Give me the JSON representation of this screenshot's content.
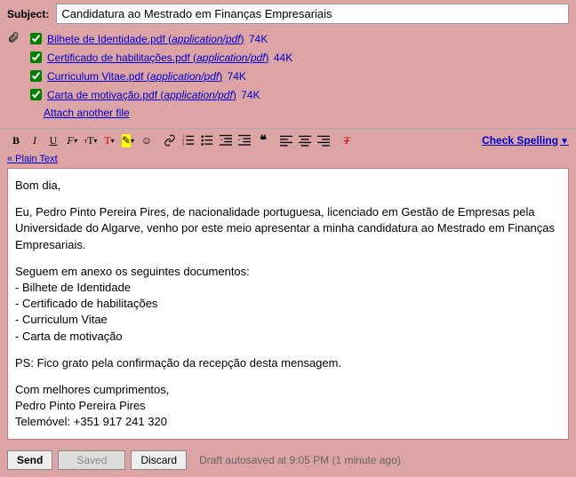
{
  "subject": {
    "label": "Subject:",
    "value": "Candidatura ao Mestrado em Finanças Empresariais"
  },
  "attachments": [
    {
      "name": "Bilhete de Identidade.pdf",
      "type": "application/pdf",
      "size": "74K"
    },
    {
      "name": "Certificado de habilitações.pdf",
      "type": "application/pdf",
      "size": "44K"
    },
    {
      "name": "Curriculum Vitae.pdf",
      "type": "application/pdf",
      "size": "74K"
    },
    {
      "name": "Carta de motivação.pdf",
      "type": "application/pdf",
      "size": "74K"
    }
  ],
  "attach_another": "Attach another file",
  "plain_text": "« Plain Text",
  "check_spelling": "Check Spelling",
  "body": {
    "p1": "Bom dia,",
    "p2": "Eu, Pedro Pinto Pereira Pires, de nacionalidade portuguesa, licenciado em Gestão de Empresas pela Universidade do Algarve, venho por este meio apresentar a minha candidatura ao Mestrado em Finanças Empresariais.",
    "p3": "Seguem em anexo os seguintes documentos:",
    "l1": "- Bilhete de Identidade",
    "l2": "- Certificado de habilitações",
    "l3": "- Curriculum Vitae",
    "l4": "- Carta de motivação",
    "p4": "PS: Fico grato pela confirmação da recepção desta mensagem.",
    "p5": "Com melhores cumprimentos,",
    "p6": "Pedro Pinto Pereira Pires",
    "p7": "Telemóvel: +351 917 241 320"
  },
  "buttons": {
    "send": "Send",
    "saved": "Saved",
    "discard": "Discard"
  },
  "autosave": "Draft autosaved at 9:05 PM (1 minute ago)"
}
